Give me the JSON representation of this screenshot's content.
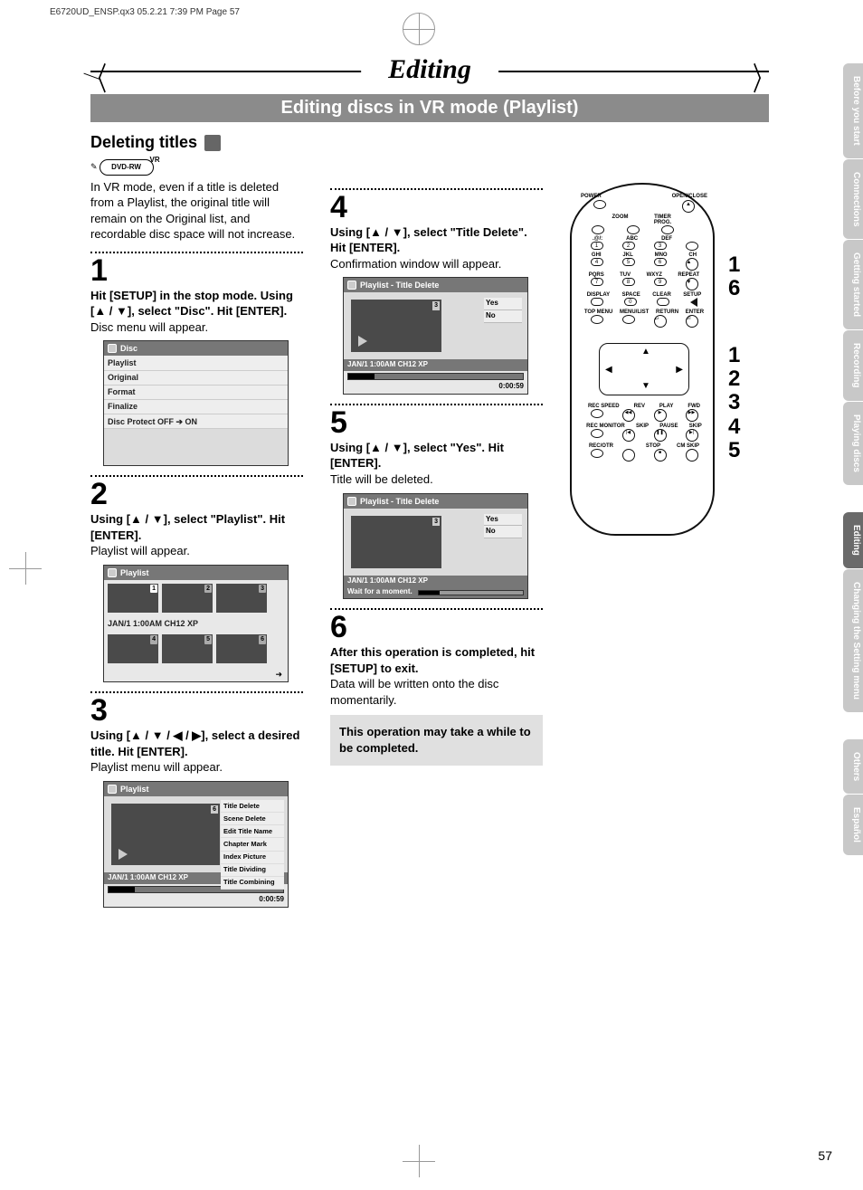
{
  "meta": {
    "doc_header": "E6720UD_ENSP.qx3  05.2.21 7:39 PM  Page 57"
  },
  "titles": {
    "main": "Editing",
    "sub": "Editing discs in VR mode (Playlist)",
    "section": "Deleting titles"
  },
  "badges": {
    "vr": "VR",
    "dvd": "DVD-RW"
  },
  "intro": "In VR mode, even if a title is deleted from a Playlist, the original title will remain on the Original list, and recordable disc space will not increase.",
  "steps": {
    "s1": {
      "num": "1",
      "head": "Hit [SETUP] in the stop mode. Using [▲ / ▼], select \"Disc\". Hit [ENTER].",
      "body": "Disc menu will appear."
    },
    "s2": {
      "num": "2",
      "head": "Using [▲ / ▼], select \"Playlist\". Hit [ENTER].",
      "body": "Playlist will appear."
    },
    "s3": {
      "num": "3",
      "head": "Using [▲ / ▼ / ◀ / ▶], select a desired title. Hit [ENTER].",
      "body": "Playlist menu will appear."
    },
    "s4": {
      "num": "4",
      "head": "Using [▲ / ▼], select \"Title Delete\". Hit [ENTER].",
      "body": "Confirmation window will appear."
    },
    "s5": {
      "num": "5",
      "head": "Using [▲ / ▼], select \"Yes\". Hit [ENTER].",
      "body": "Title will be deleted."
    },
    "s6": {
      "num": "6",
      "head": "After this operation is completed, hit [SETUP] to exit.",
      "body": "Data will be written onto the disc momentarily."
    }
  },
  "note": "This operation may take a while to be completed.",
  "osd": {
    "disc": {
      "title": "Disc",
      "items": [
        "Playlist",
        "Original",
        "Format",
        "Finalize",
        "Disc Protect OFF ➔ ON"
      ]
    },
    "playlist_grid": {
      "title": "Playlist",
      "info": "JAN/1 1:00AM CH12 XP",
      "thumbs": [
        "1",
        "2",
        "3",
        "4",
        "5",
        "6"
      ]
    },
    "playlist_menu": {
      "title": "Playlist",
      "preview_num": "6",
      "info": "JAN/1 1:00AM CH12 XP",
      "time": "0:00:59",
      "items": [
        "Title Delete",
        "Scene Delete",
        "Edit Title Name",
        "Chapter Mark",
        "Index Picture",
        "Title Dividing",
        "Title Combining"
      ]
    },
    "confirm": {
      "title": "Playlist - Title Delete",
      "preview_num": "3",
      "yes": "Yes",
      "no": "No",
      "info": "JAN/1 1:00AM CH12 XP",
      "time": "0:00:59"
    },
    "wait": {
      "title": "Playlist - Title Delete",
      "preview_num": "3",
      "yes": "Yes",
      "no": "No",
      "info": "JAN/1 1:00AM CH12 XP",
      "wait": "Wait for a moment."
    }
  },
  "remote": {
    "rows": {
      "r1": [
        "POWER",
        "",
        "",
        "OPEN/CLOSE"
      ],
      "r2": [
        "",
        "ZOOM",
        "TIMER PROG.",
        ""
      ],
      "r3": [
        ".@/:",
        "ABC",
        "DEF",
        ""
      ],
      "nums1": [
        "1",
        "2",
        "3"
      ],
      "r4": [
        "GHI",
        "JKL",
        "MNO",
        "CH"
      ],
      "nums2": [
        "4",
        "5",
        "6"
      ],
      "r5": [
        "PQRS",
        "TUV",
        "WXYZ",
        "REPEAT"
      ],
      "nums3": [
        "7",
        "8",
        "9"
      ],
      "r6": [
        "DISPLAY",
        "SPACE",
        "CLEAR",
        "SETUP"
      ],
      "nums4": [
        "",
        "0",
        "",
        ""
      ],
      "r7": [
        "TOP MENU",
        "MENU/LIST",
        "RETURN",
        "ENTER"
      ],
      "r8": [
        "REC SPEED",
        "REV",
        "PLAY",
        "FWD"
      ],
      "r9": [
        "REC MONITOR",
        "SKIP",
        "PAUSE",
        "SKIP"
      ],
      "r10": [
        "REC/OTR",
        "",
        "STOP",
        "CM SKIP"
      ]
    }
  },
  "callouts": {
    "a": [
      "1",
      "6"
    ],
    "b": [
      "1",
      "2",
      "3",
      "4",
      "5"
    ]
  },
  "tabs": [
    "Before you start",
    "Connections",
    "Getting started",
    "Recording",
    "Playing discs",
    "Editing",
    "Changing the Setting menu",
    "Others",
    "Español"
  ],
  "page_number": "57"
}
